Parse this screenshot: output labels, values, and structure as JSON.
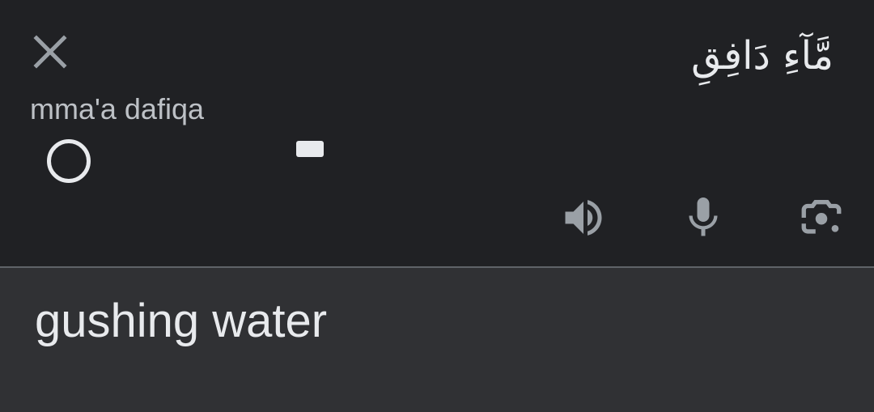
{
  "source": {
    "text": "مَّآءِ دَافِقِ",
    "transliteration": "mma'a dafiqa"
  },
  "target": {
    "text": "gushing water"
  },
  "icons": {
    "close": "close-icon",
    "speaker": "volume-icon",
    "mic": "microphone-icon",
    "lens": "camera-lens-icon"
  },
  "colors": {
    "source_bg": "#202124",
    "target_bg": "#303134",
    "text_primary": "#e8eaed",
    "text_secondary": "#bdc1c6",
    "icon": "#9aa0a6"
  }
}
